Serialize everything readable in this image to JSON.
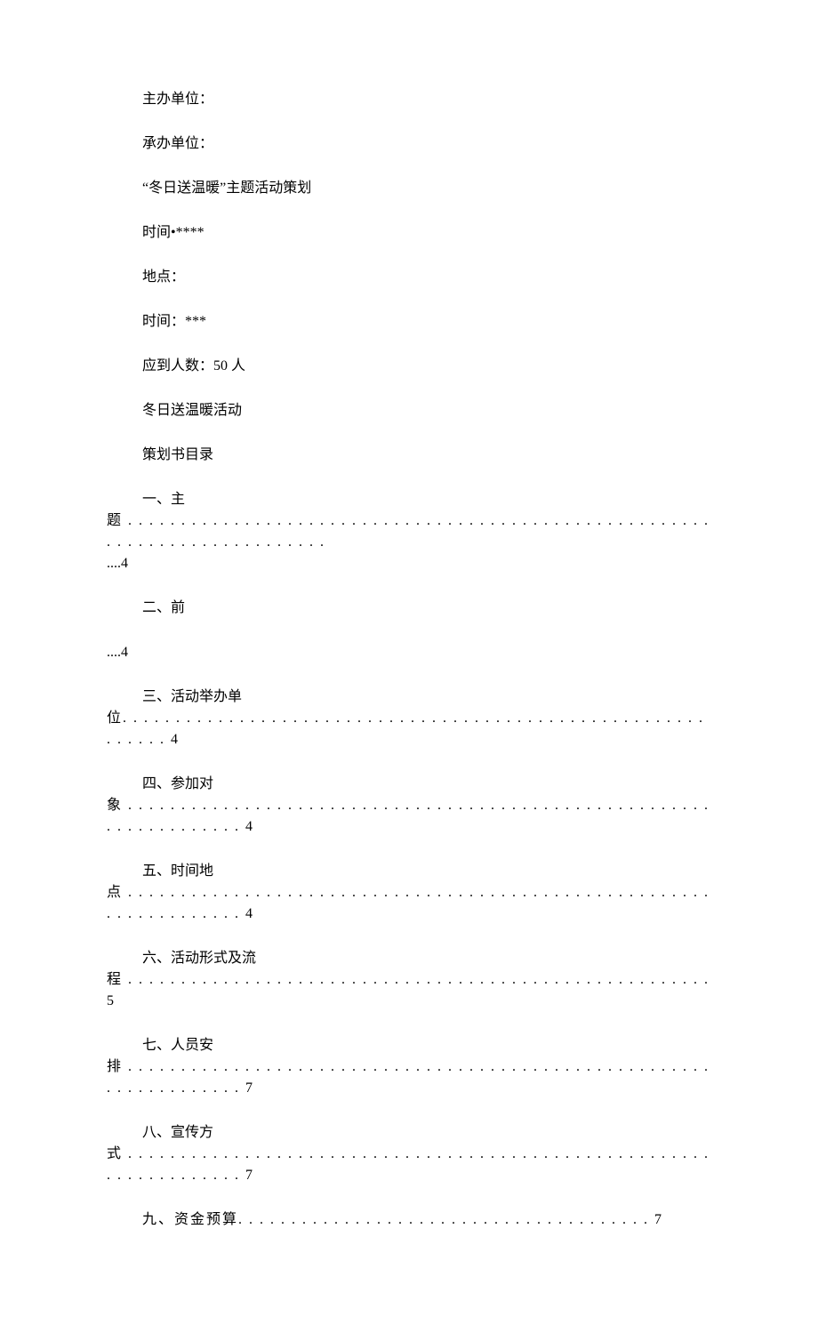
{
  "header": {
    "host_org": "主办单位：",
    "co_org": "承办单位：",
    "event_title": "“冬日送温暖”主题活动策划",
    "time1": "时间•****",
    "place": "地点：",
    "time2": "时间：***",
    "attendance": "应到人数：50 人",
    "activity_name": "冬日送温暖活动",
    "toc_title": "策划书目录"
  },
  "toc": {
    "item1_l1": "一、主",
    "item1_l2": "题 . . . . . . . . . . . . . . . . . . . . . . . . . . . . . . . . . . . . . . . . . . . . . . . . . . . . . . . . . . . . . . . . . . . . . . . . . . . .",
    "item1_l3": "....4",
    "item2_l1": "二、前",
    "item2_l2": "....4",
    "item3_l1": "三、活动举办单",
    "item3_l2": "位. . . . . . . . . . . . . . . . . . . . . . . . . . . . . . . . . . . . . . . . . . . . . . . . . . . . . . . . . . . . .  4",
    "item4_l1": "四、参加对",
    "item4_l2": "象 . . . . . . . . . . . . . . . . . . . . . . . . . . . . . . . . . . . . . . . . . . . . . . . . . . . . . . . . . . . . . . . . . . . . 4",
    "item5_l1": "五、时间地",
    "item5_l2": "点 . . . . . . . . . . . . . . . . . . . . . . . . . . . . . . . . . . . . . . . . . . . . . . . . . . . . . . . . . . . . . . . . . . . .  4",
    "item6_l1": "六、活动形式及流",
    "item6_l2": "程 . . . . . . . . . . . . . . . . . . . . . . . . . . . . . . . . . . . . . . . . . . . . . . . . . . . . . . .  5",
    "item7_l1": "七、人员安",
    "item7_l2": "排 . . . . . . . . . . . . . . . . . . . . . . . . . . . . . . . . . . . . . . . . . . . . . . . . . . . . . . . . . . . . . . . . . . . . 7",
    "item8_l1": "八、宣传方",
    "item8_l2": "式 . . . . . . . . . . . . . . . . . . . . . . . . . . . . . . . . . . . . . . . . . . . . . . . . . . . . . . . . . . . . . . . . . . . . 7",
    "item9": "九、资金预算. . . . . . . . . . . . . . . . . . . . . . . . . . . . . . . . . . . . . . . 7"
  }
}
